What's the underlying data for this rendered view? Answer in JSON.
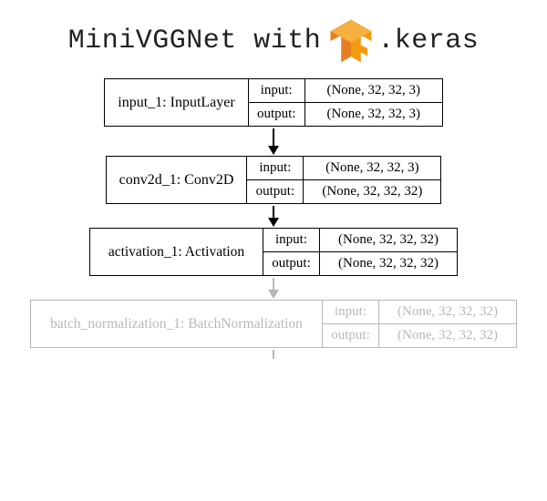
{
  "title": {
    "prefix": "MiniVGGNet with ",
    "suffix": ".keras",
    "logo_name": "tensorflow"
  },
  "labels": {
    "input": "input:",
    "output": "output:"
  },
  "layers": [
    {
      "name": "input_1: InputLayer",
      "input_shape": "(None, 32, 32, 3)",
      "output_shape": "(None, 32, 32, 3)",
      "faded": false,
      "width": "normal"
    },
    {
      "name": "conv2d_1: Conv2D",
      "input_shape": "(None, 32, 32, 3)",
      "output_shape": "(None, 32, 32, 32)",
      "faded": false,
      "width": "normal"
    },
    {
      "name": "activation_1: Activation",
      "input_shape": "(None, 32, 32, 32)",
      "output_shape": "(None, 32, 32, 32)",
      "faded": false,
      "width": "wide"
    },
    {
      "name": "batch_normalization_1: BatchNormalization",
      "input_shape": "(None, 32, 32, 32)",
      "output_shape": "(None, 32, 32, 32)",
      "faded": true,
      "width": "xwide"
    }
  ]
}
